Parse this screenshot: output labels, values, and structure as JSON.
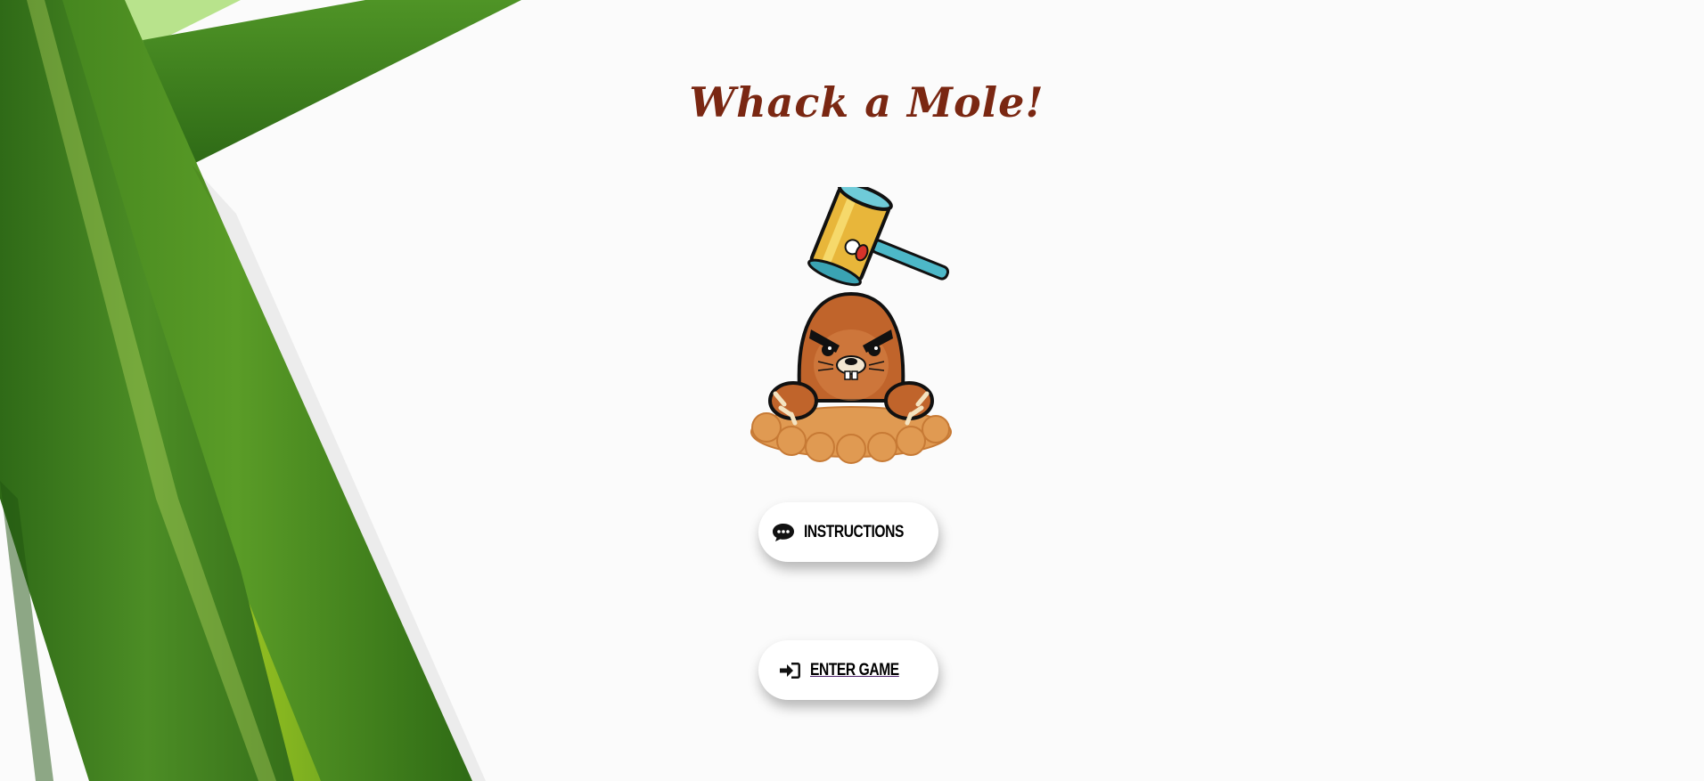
{
  "title": "Whack a Mole!",
  "buttons": {
    "instructions": {
      "label": "Instructions",
      "icon": "chat-bubble-icon"
    },
    "enter_game": {
      "label": "Enter game",
      "icon": "sign-in-icon"
    }
  },
  "illustration": "mole-with-hammer",
  "colors": {
    "title": "#7a2712",
    "leaf_dark": "#3f7a1f",
    "leaf_light": "#a6cc1c",
    "mole_body": "#c0642b",
    "dirt": "#e09a52",
    "hammer_head": "#e8b63a",
    "hammer_handle": "#4db8c8"
  }
}
